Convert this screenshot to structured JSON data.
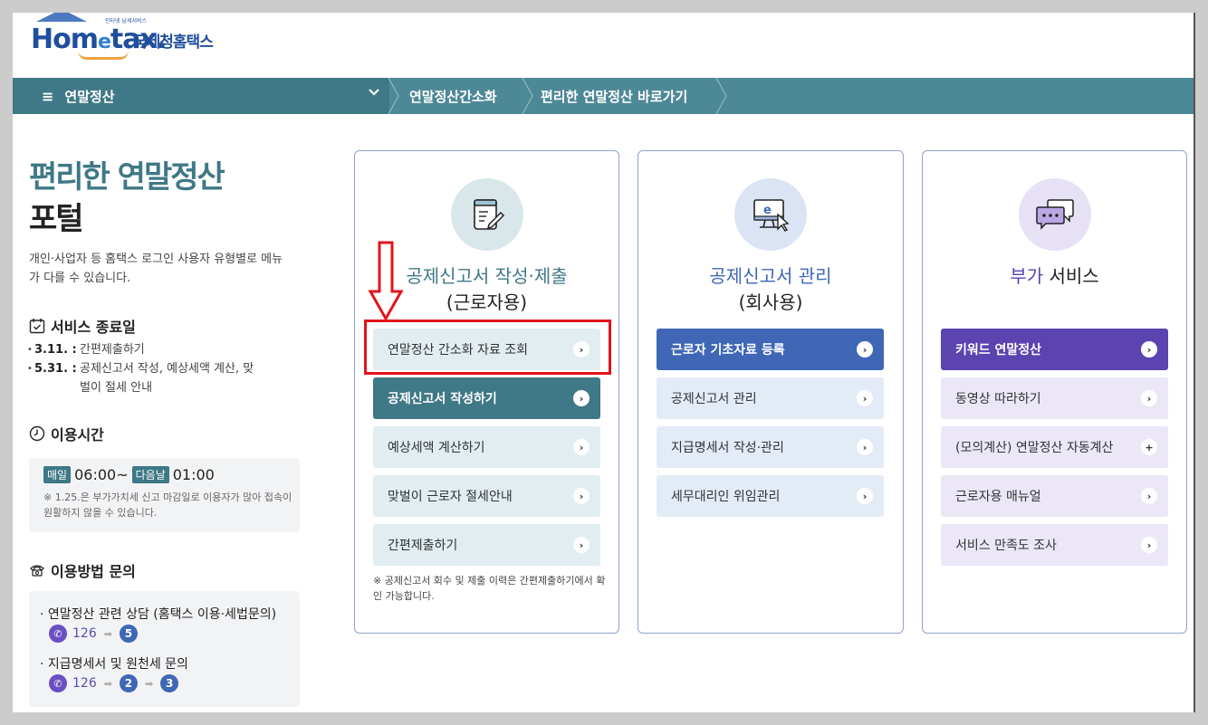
{
  "header": {
    "logo_small": "인터넷 납세서비스",
    "logo_word_1": "Hom",
    "logo_word_e": "e",
    "logo_word_2": "tax.",
    "logo_kr": "국세청홈택스"
  },
  "nav": {
    "menu_label": "연말정산",
    "menu_icon": "hamburger-icon",
    "crumbs": [
      "연말정산간소화",
      "편리한 연말정산 바로가기"
    ]
  },
  "left": {
    "title_line1": "편리한 연말정산",
    "title_line2": "포털",
    "description": "개인·사업자 등 홈택스 로그인 사용자 유형별로 메뉴가 다를 수 있습니다.",
    "end_section": {
      "title": "서비스 종료일",
      "items": [
        {
          "date": "3.11. :",
          "text": "간편제출하기"
        },
        {
          "date": "5.31. :",
          "text": "공제신고서 작성, 예상세액 계산, 맞벌이 절세 안내"
        }
      ]
    },
    "time_section": {
      "title": "이용시간",
      "daily_tag": "매일",
      "start": "06:00~",
      "next_tag": "다음날",
      "end": "01:00",
      "note": "※ 1.25.은 부가가치세 신고 마감일로 이용자가 많아 접속이 원활하지 않을 수 있습니다."
    },
    "inquiry_section": {
      "title": "이용방법 문의",
      "items": [
        {
          "label": "연말정산 관련 상담 (홈택스 이용·세법문의)",
          "number": "126",
          "steps": [
            "5"
          ]
        },
        {
          "label": "지급명세서 및 원천세 문의",
          "number": "126",
          "steps": [
            "2",
            "3"
          ]
        }
      ]
    }
  },
  "cards": [
    {
      "title_line1": "공제신고서 작성·제출",
      "title_line2": "(근로자용)",
      "buttons": [
        {
          "label": "연말정산 간소화 자료 조회",
          "style": "teal-light"
        },
        {
          "label": "공제신고서 작성하기",
          "style": "teal-dark"
        },
        {
          "label": "예상세액 계산하기",
          "style": "teal-light"
        },
        {
          "label": "맞벌이 근로자 절세안내",
          "style": "teal-light"
        },
        {
          "label": "간편제출하기",
          "style": "teal-light"
        }
      ],
      "note": "※ 공제신고서 회수 및 제출 이력은 간편제출하기에서 확인 가능합니다."
    },
    {
      "title_line1": "공제신고서 관리",
      "title_line2": "(회사용)",
      "buttons": [
        {
          "label": "근로자 기초자료 등록",
          "style": "blue-dark"
        },
        {
          "label": "공제신고서 관리",
          "style": "blue-light"
        },
        {
          "label": "지급명세서 작성·관리",
          "style": "blue-light"
        },
        {
          "label": "세무대리인 위임관리",
          "style": "blue-light"
        }
      ]
    },
    {
      "title_line1_a": "부가",
      "title_line1_b": "서비스",
      "buttons": [
        {
          "label": "키워드 연말정산",
          "style": "purple-dark"
        },
        {
          "label": "동영상 따라하기",
          "style": "purple-light"
        },
        {
          "label": "(모의계산) 연말정산 자동계산",
          "style": "purple-light",
          "icon": "+"
        },
        {
          "label": "근로자용 매뉴얼",
          "style": "purple-light"
        },
        {
          "label": "서비스 만족도 조사",
          "style": "purple-light"
        }
      ]
    }
  ],
  "colors": {
    "teal": "#3f7886",
    "blue": "#3f67b5",
    "purple": "#5b43b0",
    "highlight": "#e3141b"
  },
  "go_icon": "›"
}
